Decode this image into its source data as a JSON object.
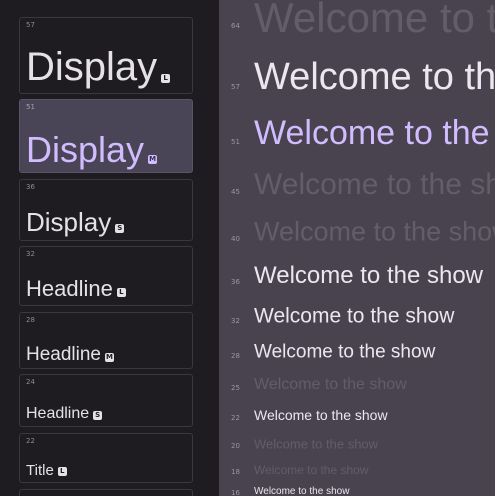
{
  "left_panel": {
    "cards": [
      {
        "size": "57",
        "label": "Display",
        "badge": "L"
      },
      {
        "size": "51",
        "label": "Display",
        "badge": "M",
        "selected": true
      },
      {
        "size": "36",
        "label": "Display",
        "badge": "S"
      },
      {
        "size": "32",
        "label": "Headline",
        "badge": "L"
      },
      {
        "size": "28",
        "label": "Headline",
        "badge": "M"
      },
      {
        "size": "24",
        "label": "Headline",
        "badge": "S"
      },
      {
        "size": "22",
        "label": "Title",
        "badge": "L"
      }
    ]
  },
  "preview": {
    "rows": [
      {
        "size": "64",
        "text": "Welcome to the show"
      },
      {
        "size": "57",
        "text": "Welcome to the show"
      },
      {
        "size": "51",
        "text": "Welcome to the show"
      },
      {
        "size": "45",
        "text": "Welcome to the show"
      },
      {
        "size": "40",
        "text": "Welcome to the show"
      },
      {
        "size": "36",
        "text": "Welcome to the show"
      },
      {
        "size": "32",
        "text": "Welcome to the show"
      },
      {
        "size": "28",
        "text": "Welcome to the show"
      },
      {
        "size": "25",
        "text": "Welcome to the show"
      },
      {
        "size": "22",
        "text": "Welcome to the show"
      },
      {
        "size": "20",
        "text": "Welcome to the show"
      },
      {
        "size": "18",
        "text": "Welcome to the show"
      },
      {
        "size": "16",
        "text": "Welcome to the show"
      }
    ]
  },
  "colors": {
    "left_bg": "#1e1c20",
    "right_bg": "#48434f",
    "selected_card_bg": "#4a4556",
    "accent": "#d0bcfe",
    "text_primary": "#e6e1e6",
    "text_faded": "#66616d"
  }
}
